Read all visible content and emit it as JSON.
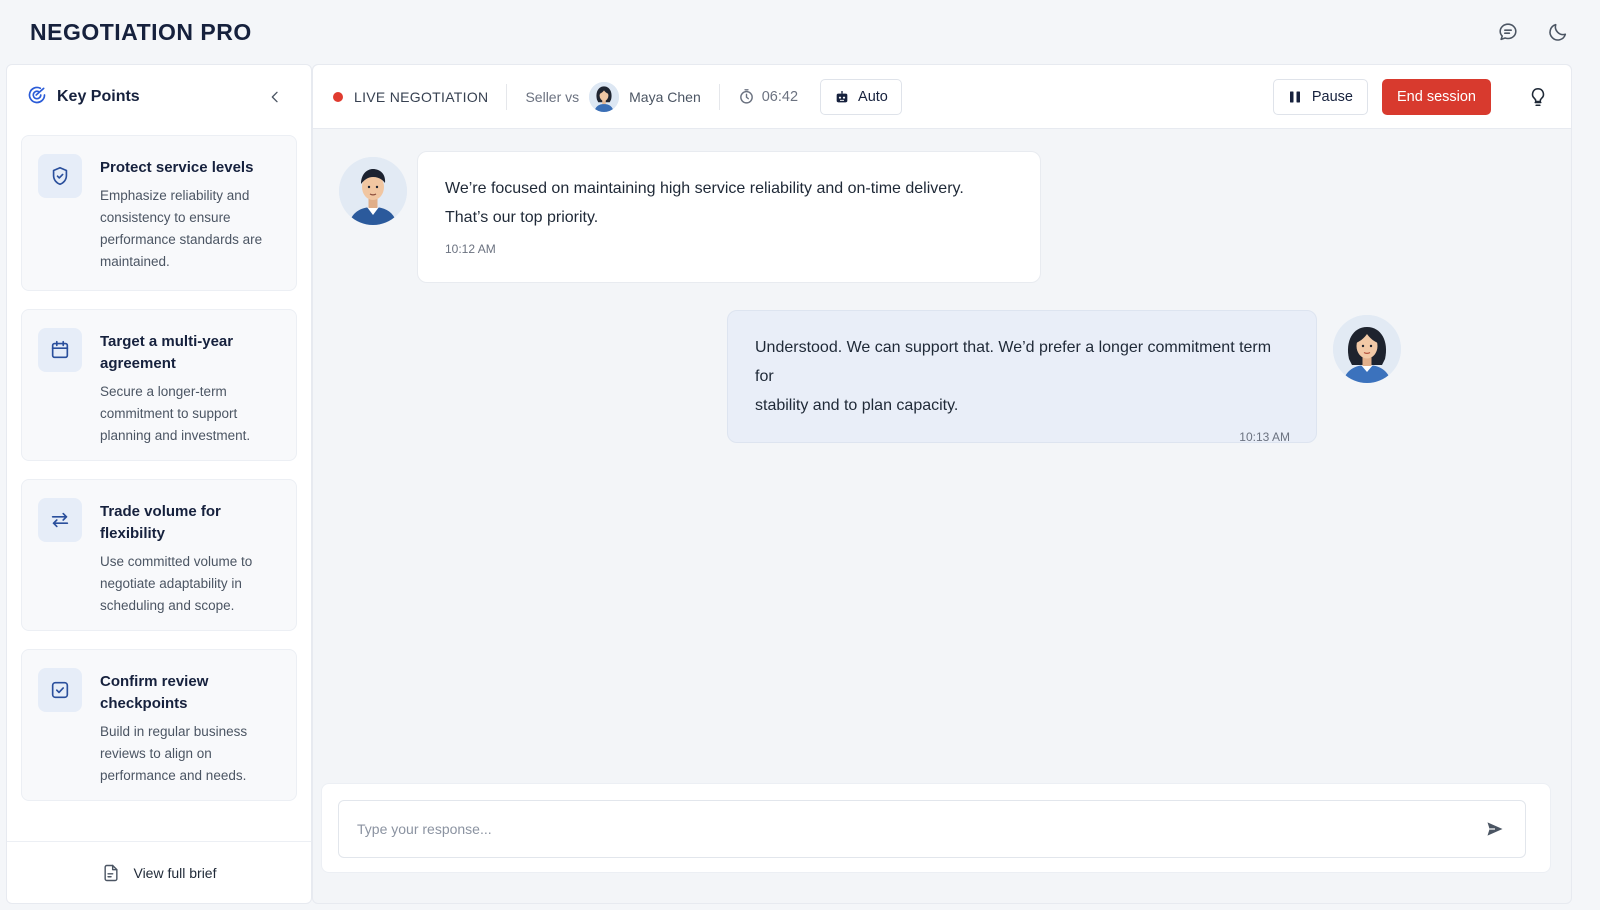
{
  "app": {
    "title": "NEGOTIATION PRO"
  },
  "header_icons": [
    "chat-bubble-icon",
    "moon-icon"
  ],
  "sidebar": {
    "title": "Key Points",
    "items": [
      {
        "icon": "shield-check-icon",
        "title": "Protect service levels",
        "description": "Emphasize reliability and consistency to ensure performance standards are maintained."
      },
      {
        "icon": "calendar-icon",
        "title": "Target a multi-year agreement",
        "description": "Secure a longer-term commitment to support planning and investment."
      },
      {
        "icon": "swap-arrows-icon",
        "title": "Trade volume for flexibility",
        "description": "Use committed volume to negotiate adaptability in scheduling and scope."
      },
      {
        "icon": "checkbox-icon",
        "title": "Confirm review checkpoints",
        "description": "Build in regular business reviews to align on performance and needs."
      }
    ],
    "footer_label": "View full brief"
  },
  "toolbar": {
    "live_label": "LIVE NEGOTIATION",
    "seller_prefix": "Seller vs",
    "counterpart_name": "Maya Chen",
    "timer": "06:42",
    "mode_label": "Auto",
    "pause_label": "Pause",
    "end_label": "End session"
  },
  "messages": [
    {
      "side": "incoming",
      "text_line1": "We’re focused on maintaining high service reliability and on-time delivery.",
      "text_line2": "That’s our top priority.",
      "time": "10:12 AM"
    },
    {
      "side": "outgoing",
      "text_line1": "Understood. We can support that. We’d prefer a longer commitment term for",
      "text_line2": "stability and to plan capacity.",
      "time": "10:13 AM"
    }
  ],
  "composer": {
    "placeholder": "Type your response..."
  },
  "colors": {
    "brand_navy": "#16213d",
    "accent_red": "#d83a2e",
    "live_dot": "#e03b2f",
    "outgoing_bubble": "#e9eef8"
  }
}
